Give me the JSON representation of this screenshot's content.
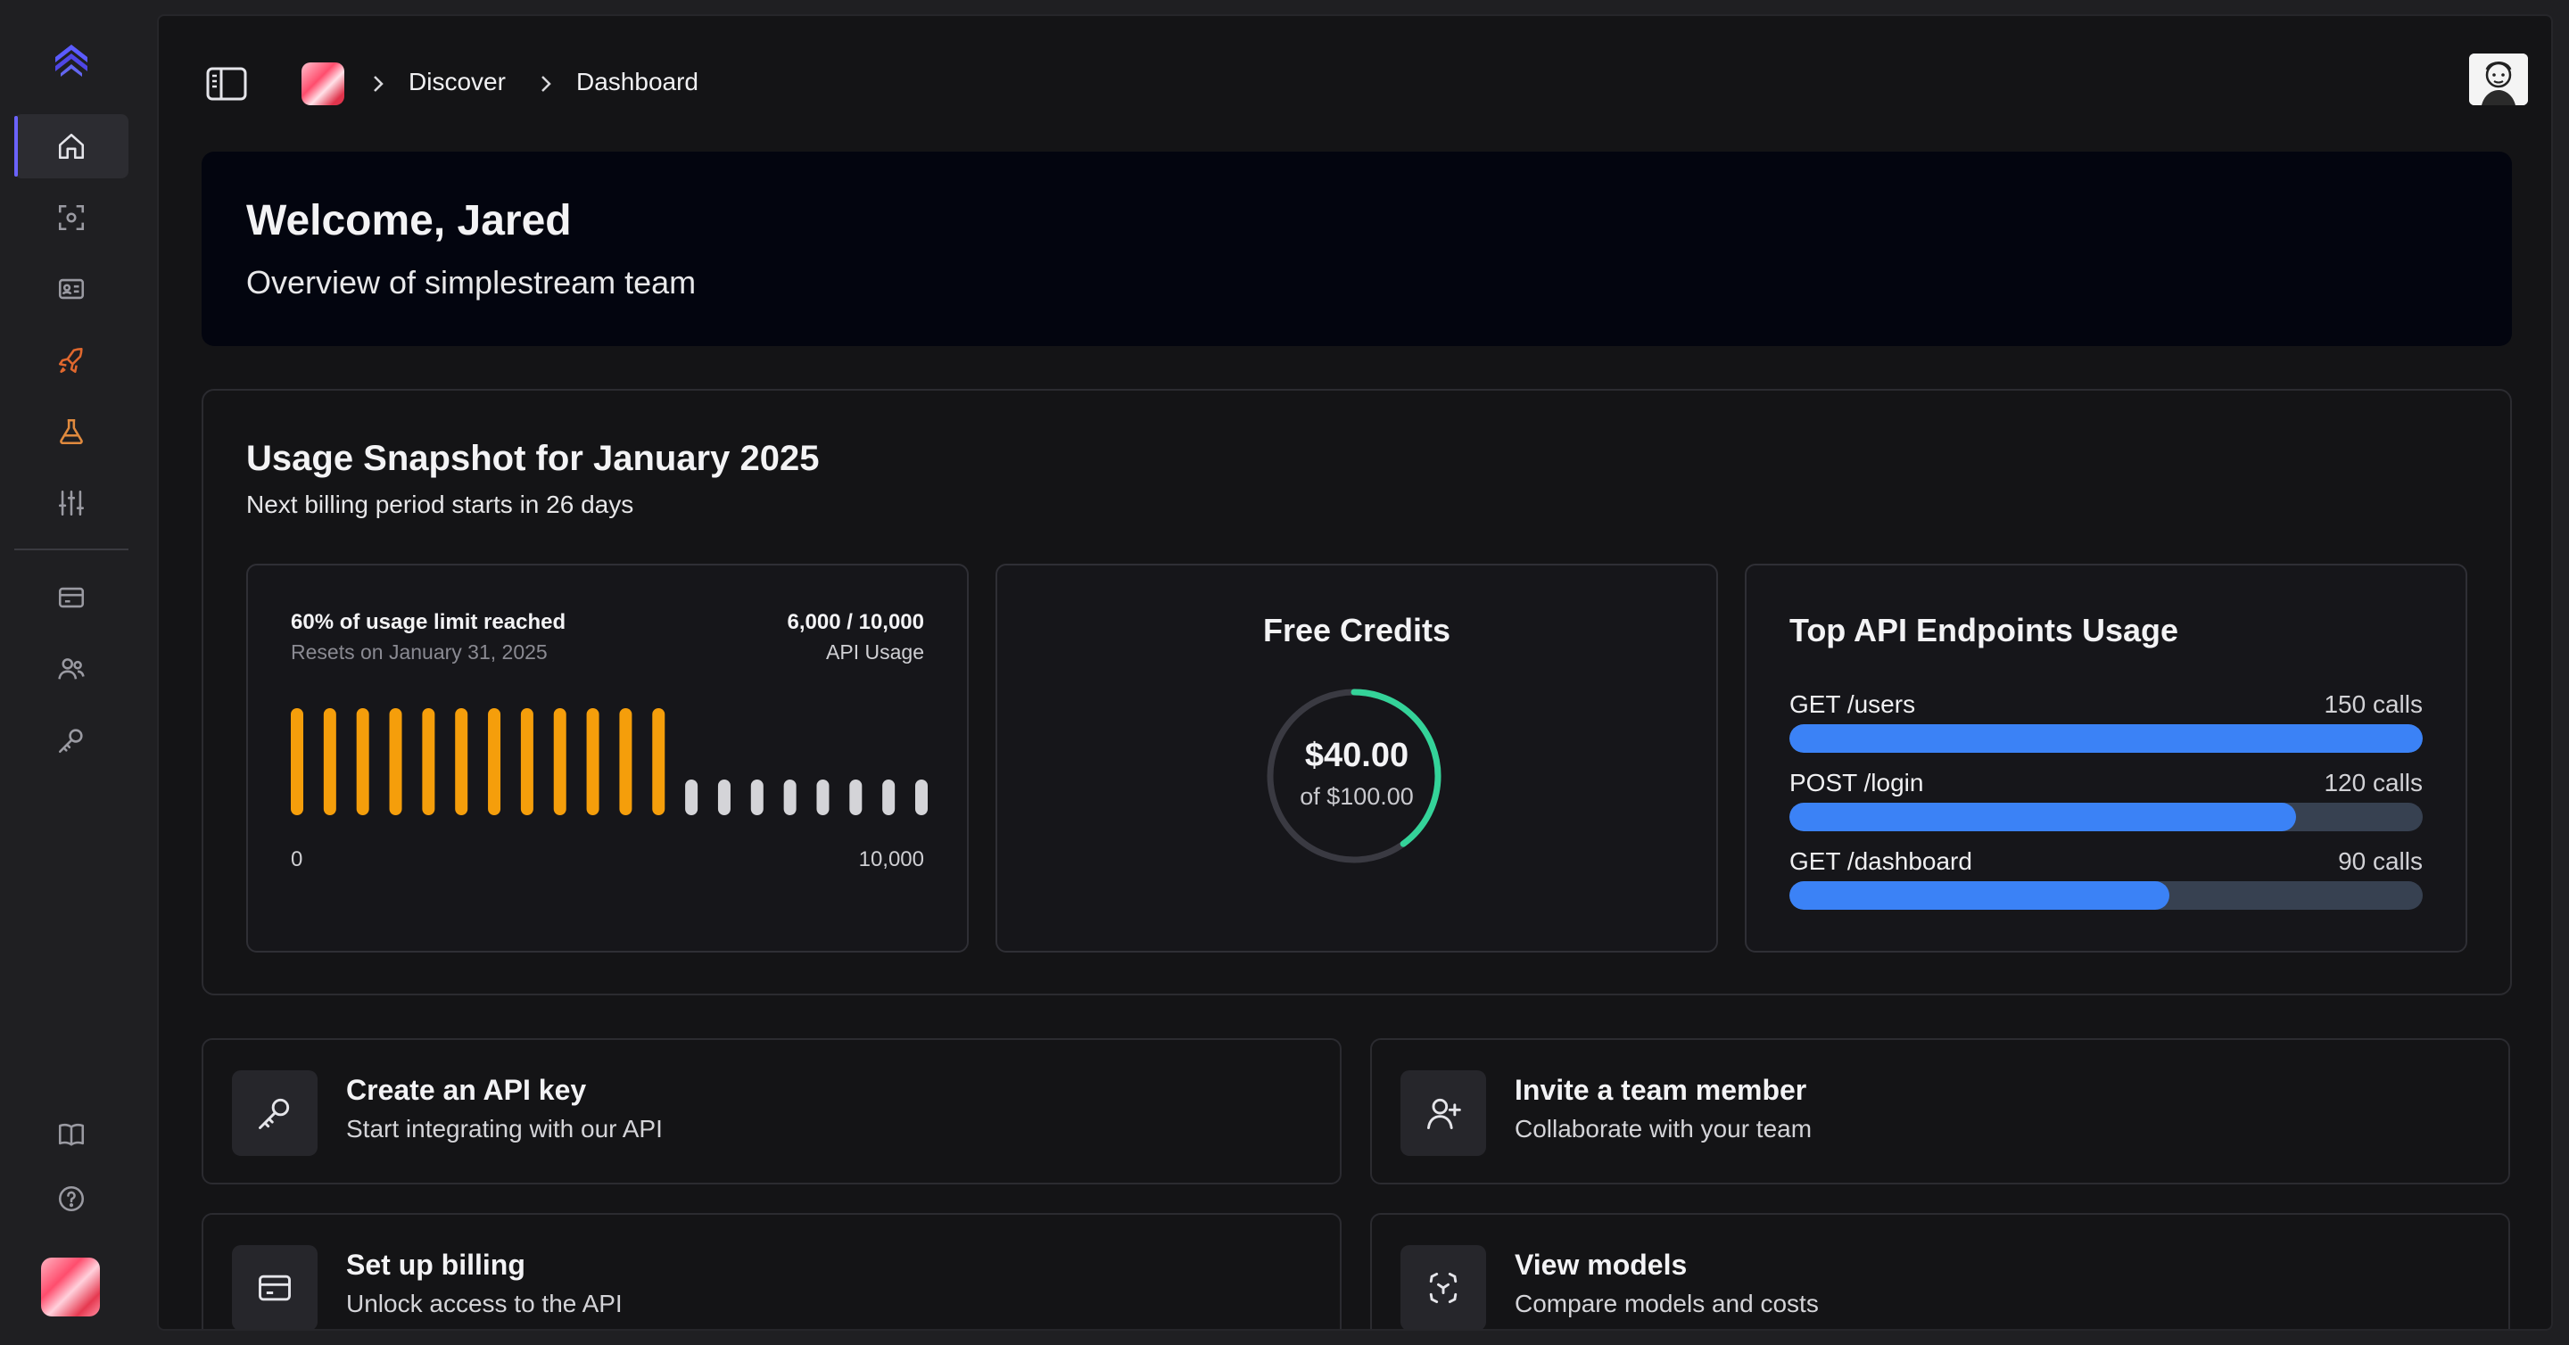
{
  "breadcrumb": {
    "items": [
      "Discover",
      "Dashboard"
    ]
  },
  "welcome": {
    "title": "Welcome, Jared",
    "subtitle": "Overview of simplestream team"
  },
  "usage": {
    "title": "Usage Snapshot for January 2025",
    "subtitle": "Next billing period starts in 26 days",
    "limit": {
      "status": "60% of usage limit reached",
      "reset": "Resets on January 31, 2025",
      "count": "6,000 / 10,000",
      "unit": "API Usage",
      "axis_min": "0",
      "axis_max": "10,000",
      "filled_fraction": 0.6,
      "total_segments": 20
    },
    "credits": {
      "title": "Free Credits",
      "amount": "$40.00",
      "of": "of $100.00",
      "fraction": 0.4
    },
    "endpoints": {
      "title": "Top API Endpoints Usage",
      "items": [
        {
          "name": "GET /users",
          "calls": "150 calls",
          "fraction": 1.0
        },
        {
          "name": "POST /login",
          "calls": "120 calls",
          "fraction": 0.8
        },
        {
          "name": "GET /dashboard",
          "calls": "90 calls",
          "fraction": 0.6
        }
      ]
    }
  },
  "actions": [
    {
      "title": "Create an API key",
      "desc": "Start integrating with our API",
      "icon": "key-icon"
    },
    {
      "title": "Invite a team member",
      "desc": "Collaborate with your team",
      "icon": "user-plus-icon"
    },
    {
      "title": "Set up billing",
      "desc": "Unlock access to the API",
      "icon": "credit-card-icon"
    },
    {
      "title": "View models",
      "desc": "Compare models and costs",
      "icon": "scan-icon"
    }
  ],
  "colors": {
    "accent": "#6b63ff",
    "usage_bar": "#f59e0b",
    "usage_bar_empty": "#d4d4d8",
    "gauge": "#34d399",
    "endpoint_bar": "#3b82f6"
  }
}
